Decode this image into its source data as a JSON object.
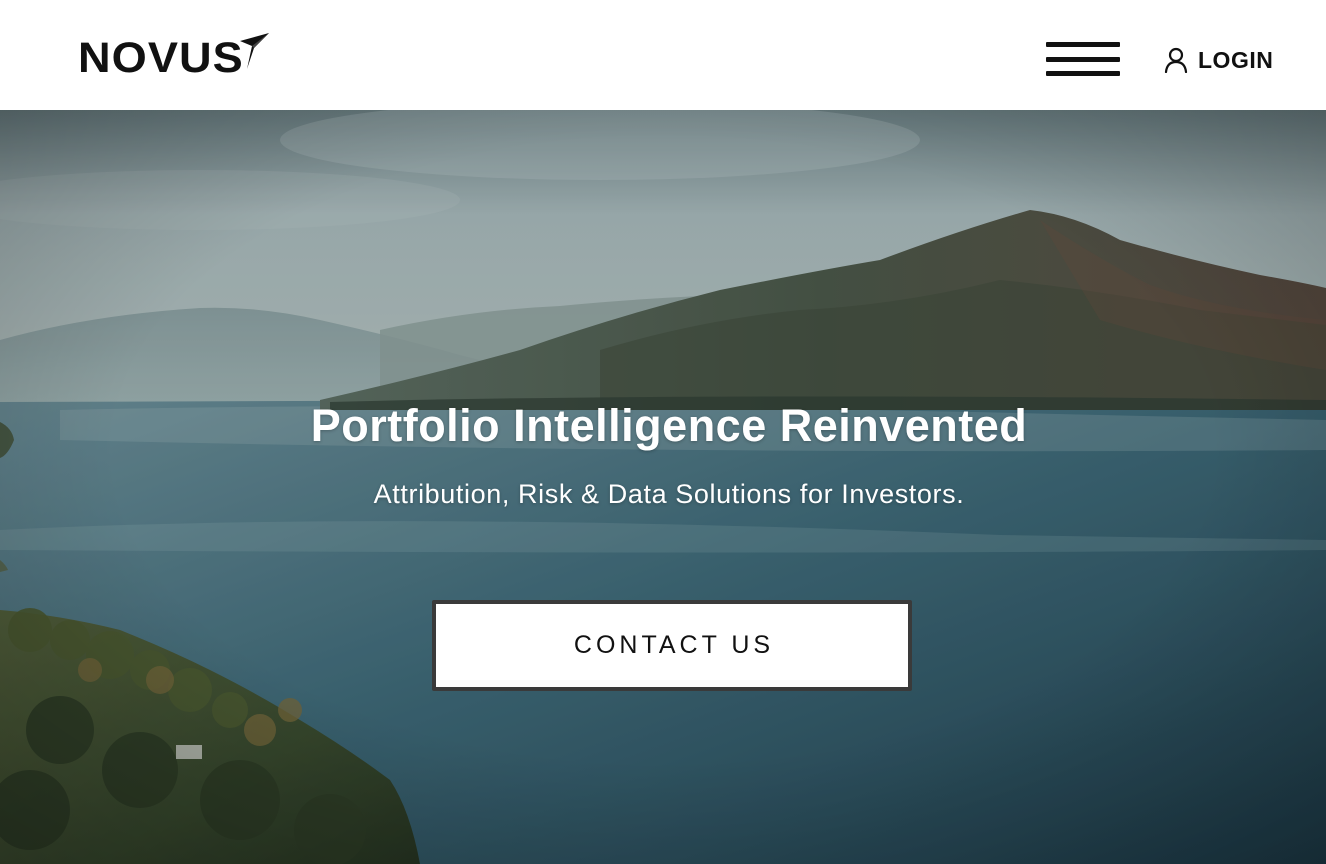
{
  "brand": {
    "logo_text": "NOVUS"
  },
  "header": {
    "menu_icon": "hamburger-menu-icon",
    "login_icon": "user-icon",
    "login_label": "LOGIN"
  },
  "hero": {
    "title": "Portfolio Intelligence Reinvented",
    "subtitle": "Attribution, Risk & Data Solutions for Investors.",
    "cta_label": "CONTACT US"
  },
  "colors": {
    "header_bg": "#ffffff",
    "text_dark": "#111111",
    "hero_text": "#ffffff",
    "button_border": "#3a3a3a",
    "sky": "#a9b8b8",
    "water": "#2f5566",
    "mountains": "#3f4a3c"
  }
}
